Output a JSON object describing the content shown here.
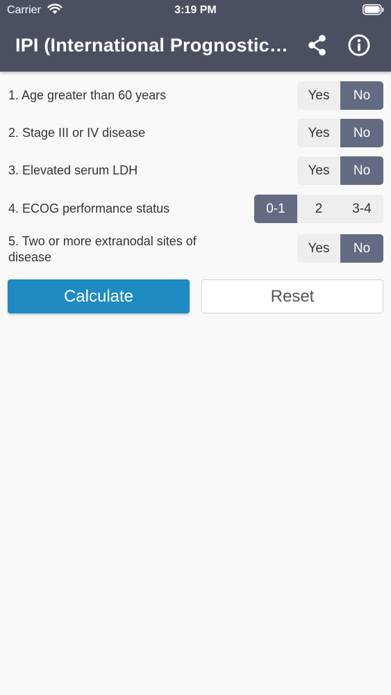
{
  "status": {
    "carrier": "Carrier",
    "time": "3:19 PM"
  },
  "nav": {
    "title": "IPI (International Prognostic Index)"
  },
  "questions": [
    {
      "label": "1. Age greater than 60 years",
      "options": [
        "Yes",
        "No"
      ],
      "selected": "No"
    },
    {
      "label": "2. Stage III or IV disease",
      "options": [
        "Yes",
        "No"
      ],
      "selected": "No"
    },
    {
      "label": "3. Elevated serum LDH",
      "options": [
        "Yes",
        "No"
      ],
      "selected": "No"
    },
    {
      "label": "4. ECOG performance status",
      "options": [
        "0-1",
        "2",
        "3-4"
      ],
      "selected": "0-1"
    },
    {
      "label": "5. Two or more extranodal sites of disease",
      "options": [
        "Yes",
        "No"
      ],
      "selected": "No"
    }
  ],
  "actions": {
    "calculate_label": "Calculate",
    "reset_label": "Reset"
  },
  "colors": {
    "header": "#4a5060",
    "selected": "#636b82",
    "primary": "#1e8bc3"
  }
}
